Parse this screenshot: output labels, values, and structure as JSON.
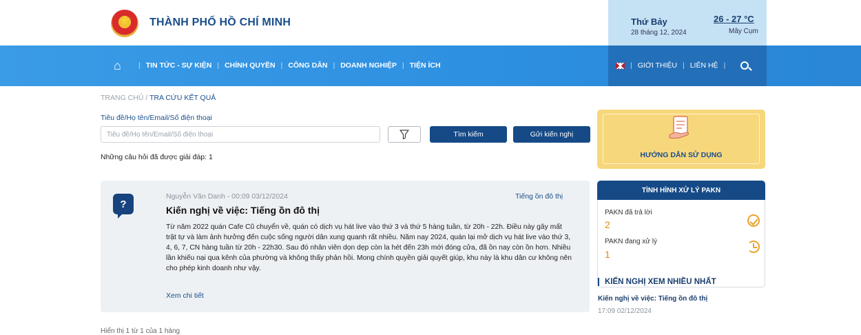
{
  "header": {
    "city_title": "THÀNH PHỐ HỒ CHÍ MINH",
    "weather": {
      "day": "Thứ Bảy",
      "date": "28 tháng 12, 2024",
      "temp": "26 - 27 °C",
      "desc": "Mây Cụm"
    }
  },
  "nav": {
    "items": [
      "TIN TỨC - SỰ KIỆN",
      "CHÍNH QUYỀN",
      "CÔNG DÂN",
      "DOANH NGHIỆP",
      "TIỆN ÍCH"
    ],
    "right": [
      "GIỚI THIỆU",
      "LIÊN HỆ"
    ]
  },
  "breadcrumb": {
    "home": "TRANG CHỦ /",
    "current": "TRA CỨU KẾT QUẢ"
  },
  "search": {
    "label": "Tiêu đề/Họ tên/Email/Số điện thoại",
    "placeholder": "Tiêu đề/Họ tên/Email/Số điện thoại",
    "search_label": "Tìm kiếm",
    "send_label": "Gửi kiến nghị",
    "answered_text": "Những câu hỏi đã được giải đáp: 1"
  },
  "guide": {
    "label": "HƯỚNG DẪN SỬ DỤNG"
  },
  "question": {
    "meta": "Nguyễn Văn Danh - 00:09 03/12/2024",
    "tag": "Tiếng ồn đô thị",
    "title": "Kiến nghị về việc: Tiếng ồn đô thị",
    "body": "Từ năm 2022 quán Cafe Cũ chuyển về, quán có dịch vụ hát live vào thứ 3 và thứ 5 hàng tuần, từ 20h - 22h. Điều này gây mất trật tự và làm ảnh hưởng đến cuộc sống người dân xung quanh rất nhiều. Năm nay 2024, quán lại mở dịch vụ hát live vào thứ 3, 4, 6, 7, CN hàng tuần từ 20h - 22h30. Sau đó nhân viên dọn dẹp còn la hét đến 23h mới đóng cửa, đã ồn nay còn ồn hơn. Nhiều lần khiếu nại qua kênh của phường và không thấy phản hồi. Mong chính quyền giải quyết giúp, khu này là khu dân cư không nên cho phép kinh doanh như vậy.",
    "more": "Xem chi tiết"
  },
  "paging": "Hiển thị 1 từ 1 của 1 hàng",
  "status": {
    "title": "TÌNH HÌNH XỬ LÝ PAKN",
    "answered_label": "PAKN đã trả lời",
    "answered_value": "2",
    "processing_label": "PAKN đang xử lý",
    "processing_value": "1"
  },
  "popular": {
    "title": "KIẾN NGHỊ XEM NHIỀU NHẤT",
    "item": "Kiến nghị về việc: Tiếng ồn đô thị",
    "time": "17:09 02/12/2024"
  },
  "colors": {
    "brand_dark": "#154a87",
    "nav_blue": "#2d8fe0",
    "guide_yellow": "#f7d77c",
    "status_orange": "#e9a22f"
  }
}
